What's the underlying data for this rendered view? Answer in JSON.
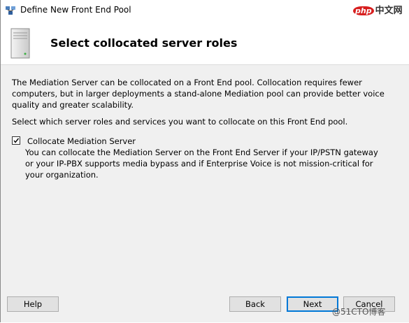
{
  "window": {
    "title": "Define New Front End Pool"
  },
  "watermark_top": {
    "brand": "php",
    "text": "中文网"
  },
  "header": {
    "title": "Select collocated server roles"
  },
  "content": {
    "intro": "The Mediation Server can be collocated on a Front End pool. Collocation requires fewer computers, but in larger deployments a stand-alone Mediation pool can provide better voice quality and greater scalability.",
    "instruction": "Select which server roles and services you want to collocate on this Front End pool.",
    "option": {
      "label": "Collocate Mediation Server",
      "checked": true,
      "description": "You can collocate the Mediation Server on the Front End Server if your IP/PSTN gateway or your IP-PBX supports media bypass and if Enterprise Voice is not mission-critical for your organization."
    }
  },
  "buttons": {
    "help": "Help",
    "back": "Back",
    "next": "Next",
    "cancel": "Cancel"
  },
  "watermark_bottom": "@51CTO博客",
  "colors": {
    "content_bg": "#f0f0f0",
    "button_bg": "#e1e1e1",
    "default_button_border": "#0078d7"
  }
}
